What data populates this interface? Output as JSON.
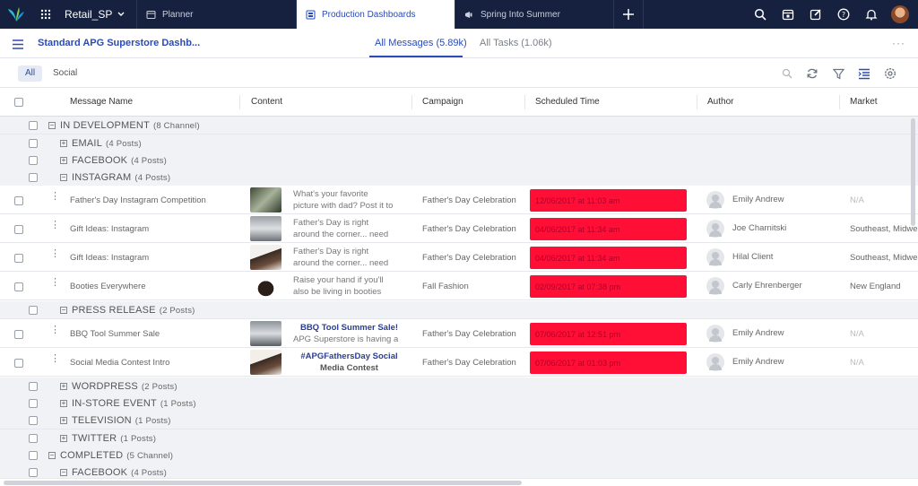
{
  "topbar": {
    "workspace": "Retail_SP",
    "tabs": [
      {
        "label": "Planner"
      },
      {
        "label": "Production Dashboards"
      },
      {
        "label": "Spring Into Summer"
      }
    ],
    "icons": [
      "search-icon",
      "calendar-icon",
      "compose-icon",
      "help-icon",
      "bell-icon",
      "avatar"
    ]
  },
  "header": {
    "title": "Standard APG Superstore Dashb...",
    "tabs": [
      {
        "label": "All Messages (5.89k)"
      },
      {
        "label": "All Tasks (1.06k)"
      }
    ],
    "more": "···"
  },
  "filters": {
    "chips": [
      "All",
      "Social"
    ]
  },
  "columns": [
    "Message Name",
    "Content",
    "Campaign",
    "Scheduled Time",
    "Author",
    "Market"
  ],
  "groups": {
    "in_dev": {
      "label": "IN DEVELOPMENT",
      "count": "(8 Channel)"
    },
    "email": {
      "label": "EMAIL",
      "count": "(4 Posts)"
    },
    "facebook": {
      "label": "FACEBOOK",
      "count": "(4 Posts)"
    },
    "instagram": {
      "label": "INSTAGRAM",
      "count": "(4 Posts)"
    },
    "press": {
      "label": "PRESS RELEASE",
      "count": "(2 Posts)"
    },
    "wordpress": {
      "label": "WORDPRESS",
      "count": "(2 Posts)"
    },
    "instore": {
      "label": "IN-STORE EVENT",
      "count": "(1 Posts)"
    },
    "tv": {
      "label": "TELEVISION",
      "count": "(1 Posts)"
    },
    "twitter": {
      "label": "TWITTER",
      "count": "(1 Posts)"
    },
    "completed": {
      "label": "COMPLETED",
      "count": "(5 Channel)"
    },
    "facebook2": {
      "label": "FACEBOOK",
      "count": "(4 Posts)"
    }
  },
  "rows": [
    {
      "name": "Father's Day Instagram Competition",
      "content_l1": "What's your favorite",
      "content_l2": "picture with dad? Post it to",
      "campaign": "Father's Day Celebration",
      "scheduled": "12/06/2017 at 11:03 am",
      "author": "Emily Andrew",
      "market": "N/A"
    },
    {
      "name": "Gift Ideas: Instagram",
      "content_l1": "Father's Day is right",
      "content_l2": "around the corner... need",
      "campaign": "Father's Day Celebration",
      "scheduled": "04/06/2017 at 11:34 am",
      "author": "Joe Charnitski",
      "market": "Southeast, Midwe"
    },
    {
      "name": "Gift Ideas: Instagram",
      "content_l1": "Father's Day is right",
      "content_l2": "around the corner... need",
      "campaign": "Father's Day Celebration",
      "scheduled": "04/06/2017 at 11:34 am",
      "author": "Hilal Client",
      "market": "Southeast, Midwe"
    },
    {
      "name": "Booties Everywhere",
      "content_l1": "Raise your hand if you'll",
      "content_l2": "also be living in booties",
      "campaign": "Fall Fashion",
      "scheduled": "02/09/2017 at 07:38 pm",
      "author": "Carly Ehrenberger",
      "market": "New England"
    },
    {
      "name": "BBQ Tool Summer Sale",
      "content_l1": "BBQ Tool Summer Sale!",
      "content_l2": "APG Superstore is having a",
      "campaign": "Father's Day Celebration",
      "scheduled": "07/06/2017 at 12:51 pm",
      "author": "Emily Andrew",
      "market": "N/A"
    },
    {
      "name": "Social Media Contest Intro",
      "content_l1": "#APGFathersDay Social",
      "content_l2": "Media Contest",
      "campaign": "Father's Day Celebration",
      "scheduled": "07/06/2017 at 01:03 pm",
      "author": "Emily Andrew",
      "market": "N/A"
    }
  ]
}
